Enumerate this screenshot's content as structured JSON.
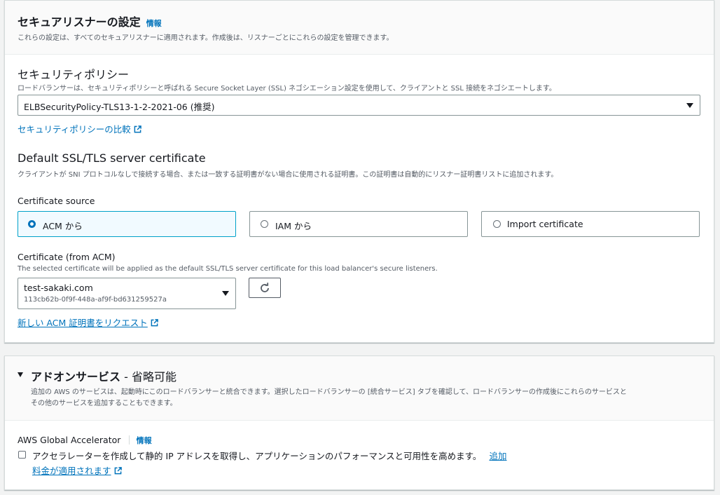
{
  "listener": {
    "title": "セキュアリスナーの設定",
    "info": "情報",
    "description": "これらの設定は、すべてのセキュアリスナーに適用されます。作成後は、リスナーごとにこれらの設定を管理できます。",
    "policy": {
      "heading": "セキュリティポリシー",
      "description": "ロードバランサーは、セキュリティポリシーと呼ばれる Secure Socket Layer (SSL) ネゴシエーション設定を使用して、クライアントと SSL 接続をネゴシエートします。",
      "selected": "ELBSecurityPolicy-TLS13-1-2-2021-06 (推奨)",
      "compare_link": "セキュリティポリシーの比較"
    },
    "certificate": {
      "heading": "Default SSL/TLS server certificate",
      "description": "クライアントが SNI プロトコルなしで接続する場合、または一致する証明書がない場合に使用される証明書。この証明書は自動的にリスナー証明書リストに追加されます。",
      "source_label": "Certificate source",
      "sources": [
        {
          "label": "ACM から",
          "selected": true
        },
        {
          "label": "IAM から",
          "selected": false
        },
        {
          "label": "Import certificate",
          "selected": false
        }
      ],
      "acm_label": "Certificate (from ACM)",
      "acm_description": "The selected certificate will be applied as the default SSL/TLS server certificate for this load balancer's secure listeners.",
      "selected_name": "test-sakaki.com",
      "selected_id": "113cb62b-0f9f-448a-af9f-bd631259527a",
      "request_link": "新しい ACM 証明書をリクエスト"
    }
  },
  "addons": {
    "title": "アドオンサービス",
    "title_suffix": "- 省略可能",
    "description_line1": "追加の AWS のサービスは、起動時にこのロードバランサーと統合できます。選択したロードバランサーの [統合サービス] タブを確認して、ロードバランサーの作成後にこれらのサービスと",
    "description_line2": "その他のサービスを追加することもできます。",
    "accelerator": {
      "label": "AWS Global Accelerator",
      "info": "情報",
      "checkbox_label": "アクセラレーターを作成して静的 IP アドレスを取得し、アプリケーションのパフォーマンスと可用性を高めます。",
      "checked": false,
      "add_link": "追加",
      "pricing_link": "料金が適用されます"
    }
  },
  "colors": {
    "link": "#0073bb",
    "selected_border": "#00a1c9",
    "selected_bg": "#f1faff"
  },
  "icons": [
    "external-link-icon",
    "refresh-icon",
    "caret-down-icon",
    "expand-triangle-icon"
  ]
}
